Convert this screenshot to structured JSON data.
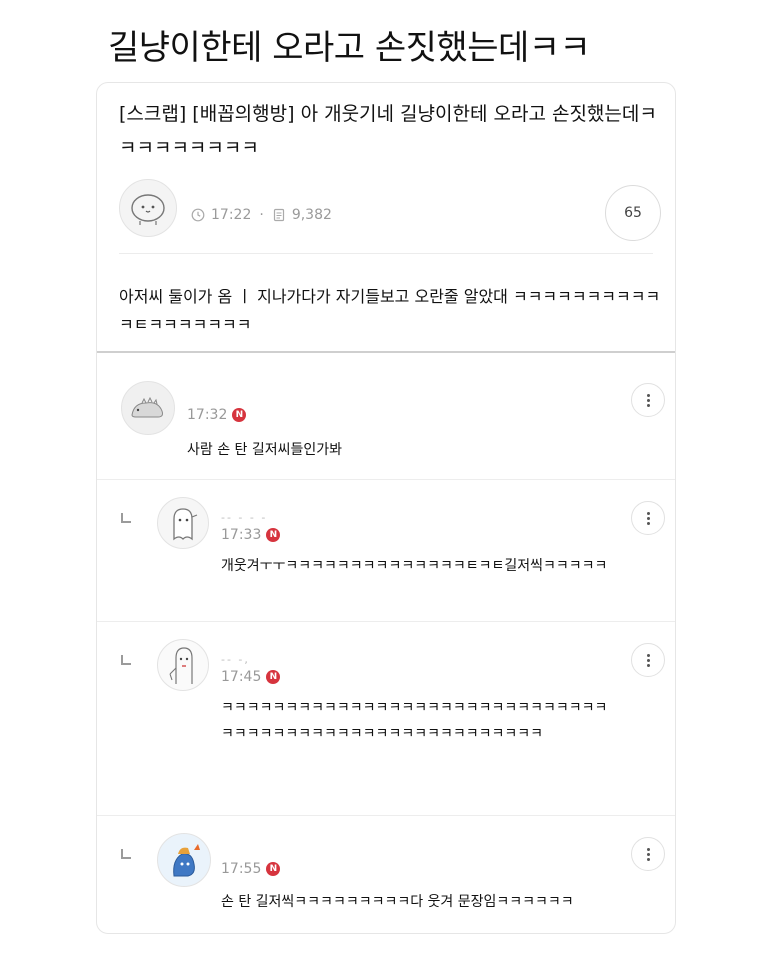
{
  "headline": "길냥이한테 오라고 손짓했는데ㅋㅋ",
  "post": {
    "title": "[스크랩] [배꼽의행방] 아        개웃기네 길냥이한테 오라고 손짓했는데ㅋㅋㅋㅋㅋㅋㅋㅋㅋ",
    "time": "17:22",
    "separator": "·",
    "views": "9,382",
    "comment_count": "65",
    "body": "아저씨 둘이가 옴      ㅣ 지나가다가 자기들보고 오란줄 알았대 ㅋㅋㅋㅋㅋㅋㅋㅋㅋㅋㅋㅌㅋㅋㅋㅋㅋㅋㅋ"
  },
  "comments": [
    {
      "time": "17:32",
      "badge": "N",
      "text": "사람 손 탄 길저씨들인가봐"
    },
    {
      "nick": "-- - -   -",
      "time": "17:33",
      "badge": "N",
      "text": "개웃겨ㅜㅜㅋㅋㅋㅋㅋㅋㅋㅋㅋㅋㅋㅋㅋㅋㅌㅋㅌ길저씩ㅋㅋㅋㅋㅋ"
    },
    {
      "nick": "-- -,",
      "time": "17:45",
      "badge": "N",
      "text": "ㅋㅋㅋㅋㅋㅋㅋㅋㅋㅋㅋㅋㅋㅋㅋㅋㅋㅋㅋㅋㅋㅋㅋㅋㅋㅋㅋㅋㅋㅋㅋㅋㅋㅋㅋㅋㅋㅋㅋㅋㅋㅋㅋㅋㅋㅋㅋㅋㅋㅋㅋㅋㅋㅋㅋ"
    },
    {
      "time": "17:55",
      "badge": "N",
      "text": "손 탄 길저씩ㅋㅋㅋㅋㅋㅋㅋㅋㅋ다 웃겨 문장임ㅋㅋㅋㅋㅋㅋ"
    }
  ],
  "icons": {
    "clock": "clock-icon",
    "views": "document-icon",
    "more": "more-vertical-icon",
    "reply": "reply-arrow-icon"
  }
}
